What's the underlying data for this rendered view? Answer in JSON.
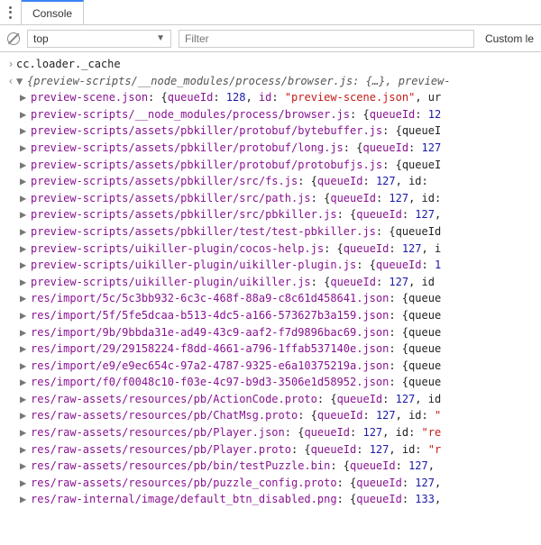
{
  "toolbar": {
    "tab_label": "Console"
  },
  "filter_bar": {
    "context": "top",
    "filter_placeholder": "Filter",
    "custom_levels": "Custom le"
  },
  "input_line": "cc.loader._cache",
  "summary": "{preview-scripts/__node_modules/process/browser.js: {…}, preview-",
  "entries": [
    {
      "key": "preview-scene.json",
      "tail": [
        {
          "t": "prop",
          "v": "queueId"
        },
        {
          "t": "punct",
          "v": ": "
        },
        {
          "t": "num",
          "v": "128"
        },
        {
          "t": "punct",
          "v": ", "
        },
        {
          "t": "prop",
          "v": "id"
        },
        {
          "t": "punct",
          "v": ": "
        },
        {
          "t": "str",
          "v": "\"preview-scene.json\""
        },
        {
          "t": "punct",
          "v": ", "
        },
        {
          "t": "plain",
          "v": "ur"
        }
      ]
    },
    {
      "key": "preview-scripts/__node_modules/process/browser.js",
      "tail": [
        {
          "t": "prop",
          "v": "queueId"
        },
        {
          "t": "punct",
          "v": ": "
        },
        {
          "t": "num",
          "v": "12"
        }
      ]
    },
    {
      "key": "preview-scripts/assets/pbkiller/protobuf/bytebuffer.js",
      "tail": [
        {
          "t": "plain",
          "v": "queueI"
        }
      ]
    },
    {
      "key": "preview-scripts/assets/pbkiller/protobuf/long.js",
      "tail": [
        {
          "t": "prop",
          "v": "queueId"
        },
        {
          "t": "punct",
          "v": ": "
        },
        {
          "t": "num",
          "v": "127"
        }
      ]
    },
    {
      "key": "preview-scripts/assets/pbkiller/protobuf/protobufjs.js",
      "tail": [
        {
          "t": "plain",
          "v": "queueI"
        }
      ]
    },
    {
      "key": "preview-scripts/assets/pbkiller/src/fs.js",
      "tail": [
        {
          "t": "prop",
          "v": "queueId"
        },
        {
          "t": "punct",
          "v": ": "
        },
        {
          "t": "num",
          "v": "127"
        },
        {
          "t": "punct",
          "v": ", "
        },
        {
          "t": "plain",
          "v": "id:"
        }
      ]
    },
    {
      "key": "preview-scripts/assets/pbkiller/src/path.js",
      "tail": [
        {
          "t": "prop",
          "v": "queueId"
        },
        {
          "t": "punct",
          "v": ": "
        },
        {
          "t": "num",
          "v": "127"
        },
        {
          "t": "punct",
          "v": ", "
        },
        {
          "t": "plain",
          "v": "id:"
        }
      ]
    },
    {
      "key": "preview-scripts/assets/pbkiller/src/pbkiller.js",
      "tail": [
        {
          "t": "prop",
          "v": "queueId"
        },
        {
          "t": "punct",
          "v": ": "
        },
        {
          "t": "num",
          "v": "127"
        },
        {
          "t": "punct",
          "v": ","
        }
      ]
    },
    {
      "key": "preview-scripts/assets/pbkiller/test/test-pbkiller.js",
      "tail": [
        {
          "t": "plain",
          "v": "queueId"
        }
      ]
    },
    {
      "key": "preview-scripts/uikiller-plugin/cocos-help.js",
      "tail": [
        {
          "t": "prop",
          "v": "queueId"
        },
        {
          "t": "punct",
          "v": ": "
        },
        {
          "t": "num",
          "v": "127"
        },
        {
          "t": "punct",
          "v": ", "
        },
        {
          "t": "plain",
          "v": "i"
        }
      ]
    },
    {
      "key": "preview-scripts/uikiller-plugin/uikiller-plugin.js",
      "tail": [
        {
          "t": "prop",
          "v": "queueId"
        },
        {
          "t": "punct",
          "v": ": "
        },
        {
          "t": "num",
          "v": "1"
        }
      ]
    },
    {
      "key": "preview-scripts/uikiller-plugin/uikiller.js",
      "tail": [
        {
          "t": "prop",
          "v": "queueId"
        },
        {
          "t": "punct",
          "v": ": "
        },
        {
          "t": "num",
          "v": "127"
        },
        {
          "t": "punct",
          "v": ", "
        },
        {
          "t": "plain",
          "v": "id"
        }
      ]
    },
    {
      "key": "res/import/5c/5c3bb932-6c3c-468f-88a9-c8c61d458641.json",
      "tail": [
        {
          "t": "plain",
          "v": "queue"
        }
      ]
    },
    {
      "key": "res/import/5f/5fe5dcaa-b513-4dc5-a166-573627b3a159.json",
      "tail": [
        {
          "t": "plain",
          "v": "queue"
        }
      ]
    },
    {
      "key": "res/import/9b/9bbda31e-ad49-43c9-aaf2-f7d9896bac69.json",
      "tail": [
        {
          "t": "plain",
          "v": "queue"
        }
      ]
    },
    {
      "key": "res/import/29/29158224-f8dd-4661-a796-1ffab537140e.json",
      "tail": [
        {
          "t": "plain",
          "v": "queue"
        }
      ]
    },
    {
      "key": "res/import/e9/e9ec654c-97a2-4787-9325-e6a10375219a.json",
      "tail": [
        {
          "t": "plain",
          "v": "queue"
        }
      ]
    },
    {
      "key": "res/import/f0/f0048c10-f03e-4c97-b9d3-3506e1d58952.json",
      "tail": [
        {
          "t": "plain",
          "v": "queue"
        }
      ]
    },
    {
      "key": "res/raw-assets/resources/pb/ActionCode.proto",
      "tail": [
        {
          "t": "prop",
          "v": "queueId"
        },
        {
          "t": "punct",
          "v": ": "
        },
        {
          "t": "num",
          "v": "127"
        },
        {
          "t": "punct",
          "v": ", "
        },
        {
          "t": "plain",
          "v": "id"
        }
      ]
    },
    {
      "key": "res/raw-assets/resources/pb/ChatMsg.proto",
      "tail": [
        {
          "t": "prop",
          "v": "queueId"
        },
        {
          "t": "punct",
          "v": ": "
        },
        {
          "t": "num",
          "v": "127"
        },
        {
          "t": "punct",
          "v": ", "
        },
        {
          "t": "plain",
          "v": "id: "
        },
        {
          "t": "str",
          "v": "\""
        }
      ]
    },
    {
      "key": "res/raw-assets/resources/pb/Player.json",
      "tail": [
        {
          "t": "prop",
          "v": "queueId"
        },
        {
          "t": "punct",
          "v": ": "
        },
        {
          "t": "num",
          "v": "127"
        },
        {
          "t": "punct",
          "v": ", "
        },
        {
          "t": "plain",
          "v": "id: "
        },
        {
          "t": "str",
          "v": "\"re"
        }
      ]
    },
    {
      "key": "res/raw-assets/resources/pb/Player.proto",
      "tail": [
        {
          "t": "prop",
          "v": "queueId"
        },
        {
          "t": "punct",
          "v": ": "
        },
        {
          "t": "num",
          "v": "127"
        },
        {
          "t": "punct",
          "v": ", "
        },
        {
          "t": "plain",
          "v": "id: "
        },
        {
          "t": "str",
          "v": "\"r"
        }
      ]
    },
    {
      "key": "res/raw-assets/resources/pb/bin/testPuzzle.bin",
      "tail": [
        {
          "t": "prop",
          "v": "queueId"
        },
        {
          "t": "punct",
          "v": ": "
        },
        {
          "t": "num",
          "v": "127"
        },
        {
          "t": "punct",
          "v": ", "
        },
        {
          "t": "plain",
          "v": ""
        }
      ]
    },
    {
      "key": "res/raw-assets/resources/pb/puzzle_config.proto",
      "tail": [
        {
          "t": "prop",
          "v": "queueId"
        },
        {
          "t": "punct",
          "v": ": "
        },
        {
          "t": "num",
          "v": "127"
        },
        {
          "t": "punct",
          "v": ","
        }
      ]
    },
    {
      "key": "res/raw-internal/image/default_btn_disabled.png",
      "tail": [
        {
          "t": "prop",
          "v": "queueId"
        },
        {
          "t": "punct",
          "v": ": "
        },
        {
          "t": "num",
          "v": "133"
        },
        {
          "t": "punct",
          "v": ","
        }
      ]
    }
  ]
}
